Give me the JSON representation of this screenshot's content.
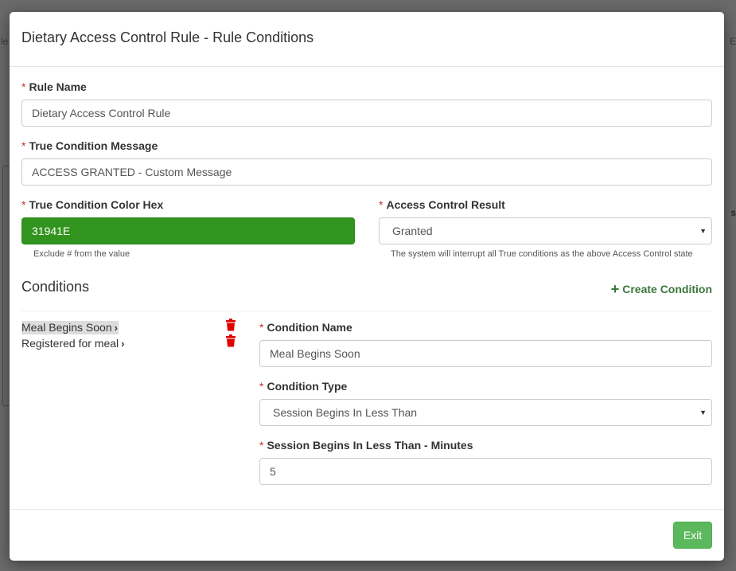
{
  "background": {
    "left_edge_text": "le",
    "right_edge_text": "E",
    "right_edge_text_2": "s"
  },
  "modal": {
    "title": "Dietary Access Control Rule - Rule Conditions"
  },
  "form": {
    "required_mark": "*",
    "rule_name": {
      "label": "Rule Name",
      "value": "Dietary Access Control Rule"
    },
    "true_condition_message": {
      "label": "True Condition Message",
      "value": "ACCESS GRANTED - Custom Message"
    },
    "true_condition_color_hex": {
      "label": "True Condition Color Hex",
      "value": "31941E",
      "color": "#31941E",
      "help": "Exclude # from the value"
    },
    "access_control_result": {
      "label": "Access Control Result",
      "selected": "Granted",
      "help": "The system will interrupt all True conditions as the above Access Control state"
    }
  },
  "conditions": {
    "title": "Conditions",
    "create_label": "Create Condition",
    "items": [
      {
        "label": "Meal Begins Soon",
        "active": true
      },
      {
        "label": "Registered for meal",
        "active": false
      }
    ],
    "detail": {
      "condition_name": {
        "label": "Condition Name",
        "value": "Meal Begins Soon"
      },
      "condition_type": {
        "label": "Condition Type",
        "selected": "Session Begins In Less Than"
      },
      "minutes": {
        "label": "Session Begins In Less Than - Minutes",
        "value": "5"
      }
    }
  },
  "footer": {
    "exit_label": "Exit"
  },
  "colors": {
    "accent_green": "#5cb85c",
    "link_green": "#3c763d",
    "required_red": "#c9302c",
    "delete_red": "#e00000"
  }
}
